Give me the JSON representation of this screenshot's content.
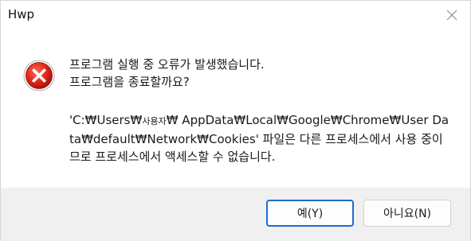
{
  "window": {
    "title": "Hwp"
  },
  "icons": {
    "close": "close-icon",
    "error": "error-icon"
  },
  "message": {
    "line1": "프로그램 실행 중 오류가 발생했습니다.",
    "line2": "프로그램을 종료할까요?",
    "detail_prefix": "'C:₩Users₩",
    "detail_user": "사용자",
    "detail_rest": "₩ AppData₩Local₩Google₩Chrome₩User Data₩default₩Network₩Cookies' 파일은 다른 프로세스에서 사용 중이므로 프로세스에서 액세스할 수 없습니다."
  },
  "buttons": {
    "yes_label": "예(Y)",
    "no_label": "아니요(N)"
  },
  "colors": {
    "error_red": "#e0281c",
    "focus_blue": "#1c6cd2",
    "footer_bg": "#f0f0f0"
  }
}
